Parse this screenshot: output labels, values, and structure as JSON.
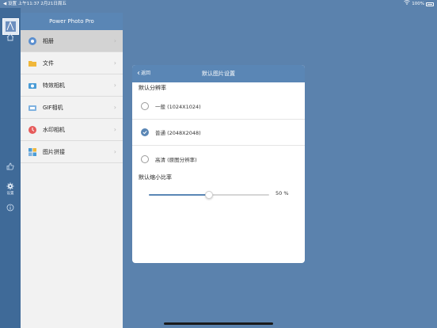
{
  "status_bar": {
    "left_text": "◀ 设置  上午11:37  2月21日周五",
    "battery_text": "100%"
  },
  "rail": {
    "settings_label": "设置"
  },
  "sidebar": {
    "title": "Power Photo Pro",
    "items": [
      {
        "label": "相册",
        "icon": "album-icon",
        "color": "#5b8fcf"
      },
      {
        "label": "文件",
        "icon": "folder-icon",
        "color": "#f0b73a"
      },
      {
        "label": "特效相机",
        "icon": "effect-camera-icon",
        "color": "#4a9cd6"
      },
      {
        "label": "GIF相机",
        "icon": "gif-camera-icon",
        "color": "#4a9cd6"
      },
      {
        "label": "水印相机",
        "icon": "watermark-camera-icon",
        "color": "#e65b5b"
      },
      {
        "label": "图片拼接",
        "icon": "collage-icon",
        "color": "#4a9cd6"
      }
    ]
  },
  "dialog": {
    "back_label": "返回",
    "title": "默认图片设置",
    "resolution_section": "默认分辨率",
    "options": [
      {
        "label": "一般 (1024X1024)",
        "checked": false
      },
      {
        "label": "普通 (2048X2048)",
        "checked": true
      },
      {
        "label": "高清 (原图分辨率)",
        "checked": false
      }
    ],
    "scale_section": "默认缩小比率",
    "slider_value": 50,
    "slider_text": "50 %"
  },
  "colors": {
    "accent": "#5a86b5",
    "background": "#5b82ad"
  }
}
